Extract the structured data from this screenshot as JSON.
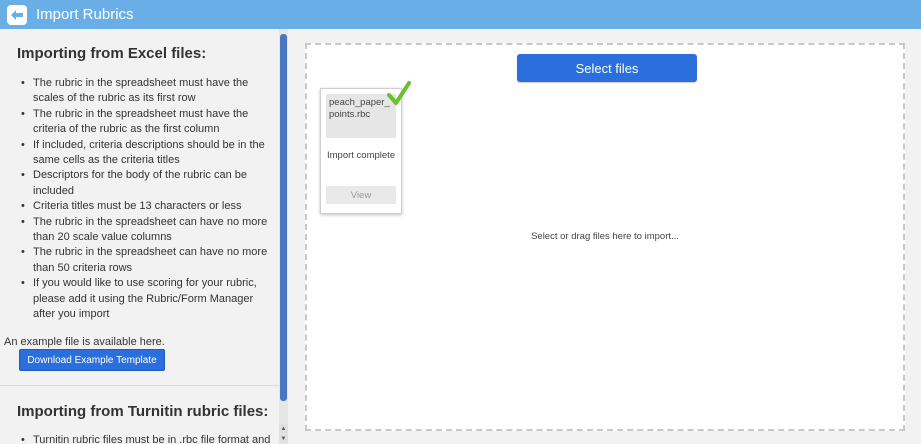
{
  "header": {
    "title": "Import Rubrics"
  },
  "left": {
    "excel_title": "Importing from Excel files:",
    "excel_rules": [
      "The rubric in the spreadsheet must have the scales of the rubric as its first row",
      "The rubric in the spreadsheet must have the criteria of the rubric as the first column",
      "If included, criteria descriptions should be in the same cells as the criteria titles",
      "Descriptors for the body of the rubric can be included",
      "Criteria titles must be 13 characters or less",
      "The rubric in the spreadsheet can have no more than 20 scale value columns",
      "The rubric in the spreadsheet can have no more than 50 criteria rows",
      "If you would like to use scoring for your rubric, please add it using the Rubric/Form Manager after you import"
    ],
    "example_text": "An example file is available here.",
    "download_label": "Download Example Template",
    "turnitin_title": "Importing from Turnitin rubric files:",
    "turnitin_rules": [
      "Turnitin rubric files must be in .rbc file format and"
    ]
  },
  "right": {
    "select_label": "Select files",
    "file": {
      "name": "peach_paper_points.rbc",
      "status": "Import complete",
      "view_label": "View"
    },
    "hint": "Select or drag files here to import..."
  },
  "colors": {
    "header": "#6aaee8",
    "primary_button": "#2b6fdc",
    "check": "#6cbf2e"
  }
}
